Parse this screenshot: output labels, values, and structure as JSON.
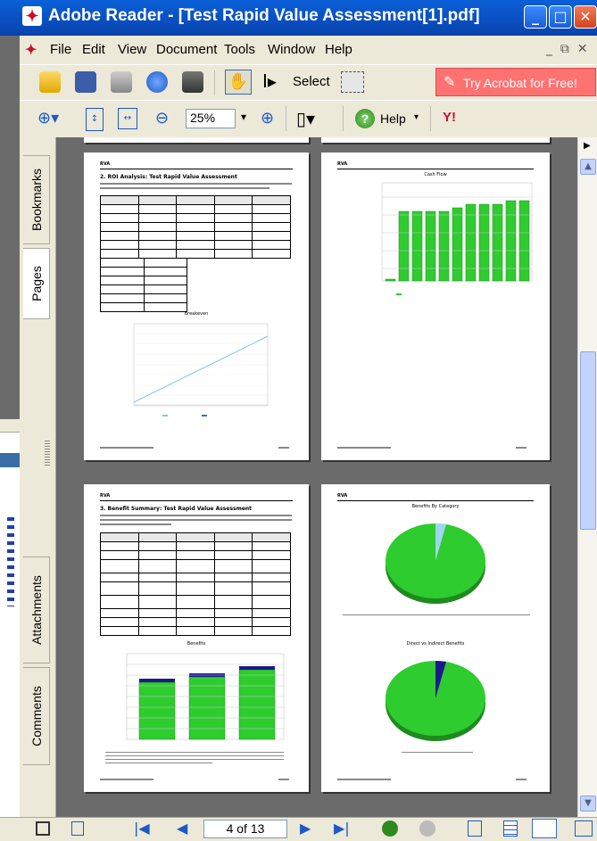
{
  "window": {
    "title": "Adobe Reader - [Test Rapid Value Assessment[1].pdf]",
    "controls": [
      "minimize",
      "maximize",
      "close"
    ]
  },
  "menubar": {
    "items": [
      {
        "label": "File"
      },
      {
        "label": "Edit"
      },
      {
        "label": "View"
      },
      {
        "label": "Document"
      },
      {
        "label": "Tools"
      },
      {
        "label": "Window"
      },
      {
        "label": "Help"
      }
    ]
  },
  "toolbar": {
    "select_label": "Select",
    "try_acrobat_label": "Try Acrobat for Free!",
    "zoom_value": "25%",
    "help_label": "Help"
  },
  "side_tabs": {
    "bookmarks": "Bookmarks",
    "pages": "Pages",
    "attachments": "Attachments",
    "comments": "Comments"
  },
  "pages": {
    "p1": {
      "title": "2. ROI Analysis: Test Rapid Value Assessment",
      "chart_title": "Breakeven"
    },
    "p2": {
      "chart_title": "Cash Flow"
    },
    "p3": {
      "title": "3. Benefit Summary: Test Rapid Value Assessment",
      "chart_title": "Benefits"
    },
    "p4": {
      "chart_title_1": "Benefits By Category",
      "chart_title_2": "Direct vs Indirect Benefits"
    }
  },
  "status": {
    "page_indicator": "4 of 13"
  },
  "colors": {
    "title_bar": "#0a4ec0",
    "chrome": "#ece9d8",
    "try_button": "#ff7272",
    "chart_green": "#2ecc2e",
    "chart_blue": "#1a1a8c"
  }
}
